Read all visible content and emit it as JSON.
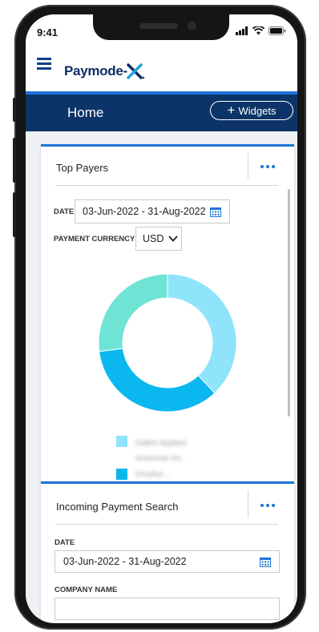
{
  "status": {
    "time": "9:41"
  },
  "app": {
    "logo_text": "Paymode-X",
    "logo_mark": "X"
  },
  "header": {
    "title": "Home",
    "widgets_label": "Widgets",
    "widgets_plus": "+"
  },
  "top_payers": {
    "title": "Top Payers",
    "date_label": "DATE",
    "date_value": "03-Jun-2022 - 31-Aug-2022",
    "currency_label": "PAYMENT CURRENCY",
    "currency_value": "USD",
    "legend": [
      {
        "name": "Daikin Applied Americas Inc.",
        "color": "#8fe3fb"
      },
      {
        "name": "Dreyfus ...",
        "color": "#0ab8ef"
      }
    ]
  },
  "chart_data": {
    "type": "pie",
    "title": "",
    "donut": true,
    "slices": [
      {
        "label": "Daikin Applied Americas Inc.",
        "value": 38,
        "color": "#8fe3fb"
      },
      {
        "label": "Dreyfus",
        "value": 35,
        "color": "#0ab8ef"
      },
      {
        "label": "",
        "value": 27,
        "color": "#6fe3d4"
      }
    ]
  },
  "incoming_search": {
    "title": "Incoming Payment Search",
    "date_label": "DATE",
    "date_value": "03-Jun-2022 - 31-Aug-2022",
    "company_label": "COMPANY NAME",
    "company_value": ""
  },
  "colors": {
    "brand_navy": "#0c3468",
    "accent_blue": "#1f74d6"
  }
}
